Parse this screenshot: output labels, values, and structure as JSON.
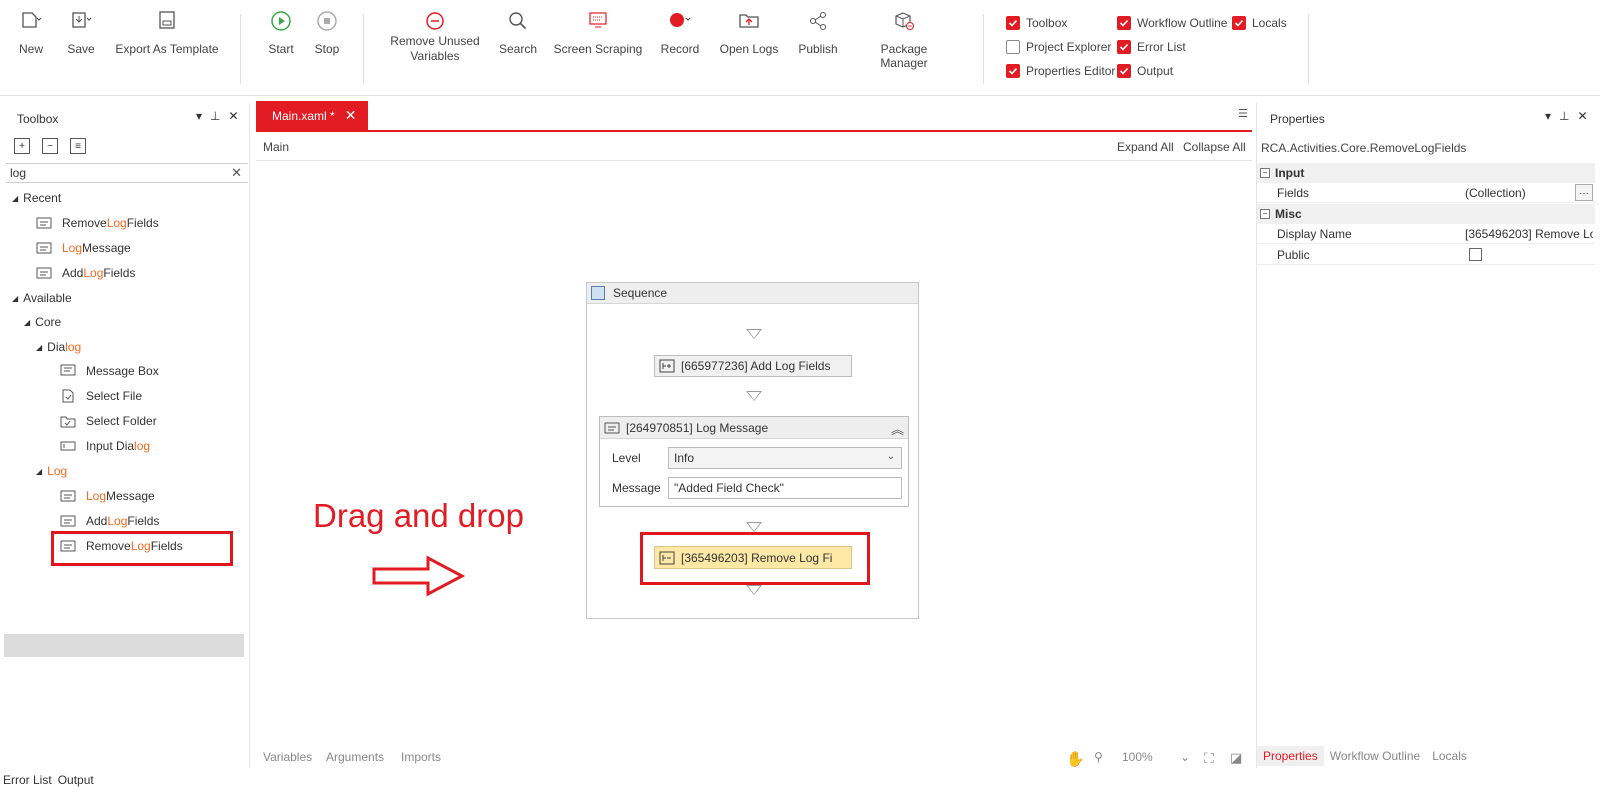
{
  "ribbon": {
    "new": "New",
    "save": "Save",
    "export_template": "Export As Template",
    "start": "Start",
    "stop": "Stop",
    "remove_unused_1": "Remove Unused",
    "remove_unused_2": "Variables",
    "search": "Search",
    "screen_scraping": "Screen Scraping",
    "record": "Record",
    "open_logs": "Open Logs",
    "publish": "Publish",
    "package_manager": "Package Manager",
    "panels": [
      {
        "label": "Toolbox",
        "checked": true
      },
      {
        "label": "Workflow Outline",
        "checked": true
      },
      {
        "label": "Locals",
        "checked": true
      },
      {
        "label": "Project Explorer",
        "checked": false
      },
      {
        "label": "Error List",
        "checked": true
      },
      {
        "label": "Properties Editor",
        "checked": true
      },
      {
        "label": "Output",
        "checked": true
      }
    ]
  },
  "toolbox": {
    "title": "Toolbox",
    "search_value": "log",
    "recent_label": "Recent",
    "available_label": "Available",
    "core_label": "Core",
    "recent": [
      {
        "pre": "Remove ",
        "hl": "Log",
        "post": " Fields"
      },
      {
        "pre": "",
        "hl": "Log",
        "post": " Message"
      },
      {
        "pre": "Add ",
        "hl": "Log",
        "post": " Fields"
      }
    ],
    "dialog_group": {
      "pre": "Dia",
      "hl": "log"
    },
    "dialog_items": [
      {
        "pre": "Message Box",
        "hl": "",
        "post": ""
      },
      {
        "pre": "Select File",
        "hl": "",
        "post": ""
      },
      {
        "pre": "Select Folder",
        "hl": "",
        "post": ""
      },
      {
        "pre": "Input Dia",
        "hl": "log",
        "post": ""
      }
    ],
    "log_group": {
      "pre": "",
      "hl": "Log"
    },
    "log_items": [
      {
        "pre": "",
        "hl": "Log",
        "post": " Message"
      },
      {
        "pre": "Add ",
        "hl": "Log",
        "post": " Fields"
      },
      {
        "pre": "Remove ",
        "hl": "Log",
        "post": " Fields"
      }
    ]
  },
  "designer": {
    "tab_label": "Main.xaml *",
    "breadcrumb": "Main",
    "expand_all": "Expand All",
    "collapse_all": "Collapse All",
    "sequence_title": "Sequence",
    "act_add": "[665977236] Add Log Fields",
    "act_log_message": "[264970851] Log Message",
    "level_label": "Level",
    "level_value": "Info",
    "message_label": "Message",
    "message_value": "\"Added Field Check\"",
    "act_remove": "[365496203] Remove Log Fi",
    "annotation": "Drag and drop",
    "bottom_variables": "Variables",
    "bottom_arguments": "Arguments",
    "bottom_imports": "Imports",
    "zoom": "100%"
  },
  "properties": {
    "title": "Properties",
    "type_name": "RCA.Activities.Core.RemoveLogFields",
    "cat_input": "Input",
    "fields_label": "Fields",
    "fields_value": "(Collection)",
    "cat_misc": "Misc",
    "display_name_label": "Display Name",
    "display_name_value": "[365496203] Remove Lo",
    "public_label": "Public",
    "tabs": [
      "Properties",
      "Workflow Outline",
      "Locals"
    ]
  },
  "bottom": {
    "error_list": "Error List",
    "output": "Output"
  },
  "colors": {
    "accent": "#e31b23",
    "highlight": "#f26a21",
    "new_activity": "#fde8a6"
  }
}
